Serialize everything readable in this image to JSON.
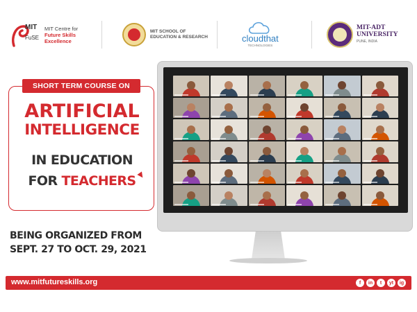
{
  "logos": {
    "futureskills": {
      "mark": "MIT",
      "mark_sub": "FuSE",
      "line1": "MIT Centre for",
      "line2": "Future Skills",
      "line3": "Excellence"
    },
    "school": {
      "line1": "MIT SCHOOL OF",
      "line2": "EDUCATION & RESEARCH"
    },
    "cloudthat": {
      "name": "cloudthat",
      "sub": "TECHNOLOGIES"
    },
    "adt": {
      "line1": "MIT-ADT",
      "line2": "UNIVERSITY",
      "line3": "PUNE, INDIA"
    }
  },
  "course": {
    "label": "SHORT TERM COURSE ON",
    "title_line1": "ARTIFICIAL",
    "title_line2": "INTELLIGENCE",
    "title_line3": "IN EDUCATION",
    "title_line4_a": "FOR ",
    "title_line4_b": "TEACHERS"
  },
  "schedule": {
    "line1": "BEING ORGANIZED FROM",
    "line2": "SEPT. 27 TO OCT. 29, 2021"
  },
  "footer": {
    "url": "www.mitfutureskills.org",
    "socials": [
      "f",
      "in",
      "t",
      "yt",
      "ig"
    ]
  },
  "colors": {
    "brand_red": "#d42a2f",
    "text_dark": "#2b2b2b"
  }
}
